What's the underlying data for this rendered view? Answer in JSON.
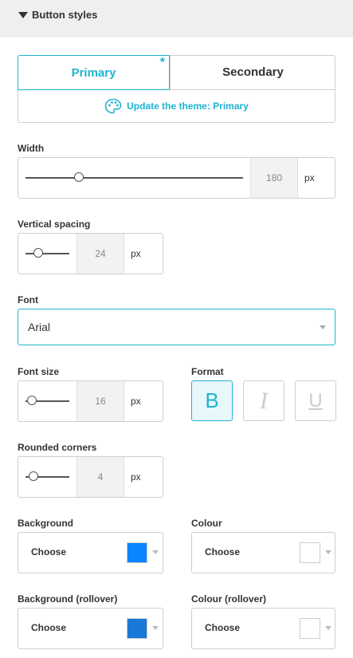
{
  "section": {
    "title": "Button styles"
  },
  "tabs": {
    "primary": "Primary",
    "primary_marker": "*",
    "secondary": "Secondary"
  },
  "theme_link": "Update the theme: Primary",
  "width": {
    "label": "Width",
    "value": "180",
    "unit": "px",
    "slider_fraction": 0.24
  },
  "vertical_spacing": {
    "label": "Vertical spacing",
    "value": "24",
    "unit": "px",
    "slider_fraction": 0.3
  },
  "font": {
    "label": "Font",
    "value": "Arial"
  },
  "font_size": {
    "label": "Font size",
    "value": "16",
    "unit": "px",
    "slider_fraction": 0.05
  },
  "format": {
    "label": "Format",
    "bold": "B",
    "italic": "I",
    "underline": "U",
    "bold_active": true
  },
  "rounded_corners": {
    "label": "Rounded corners",
    "value": "4",
    "unit": "px",
    "slider_fraction": 0.1
  },
  "background": {
    "label": "Background",
    "button": "Choose",
    "color": "#0a84ff"
  },
  "colour": {
    "label": "Colour",
    "button": "Choose",
    "color": "#ffffff"
  },
  "background_rollover": {
    "label": "Background (rollover)",
    "button": "Choose",
    "color": "#1a78d6"
  },
  "colour_rollover": {
    "label": "Colour (rollover)",
    "button": "Choose",
    "color": "#ffffff"
  },
  "colors": {
    "accent": "#1fb4d0"
  }
}
